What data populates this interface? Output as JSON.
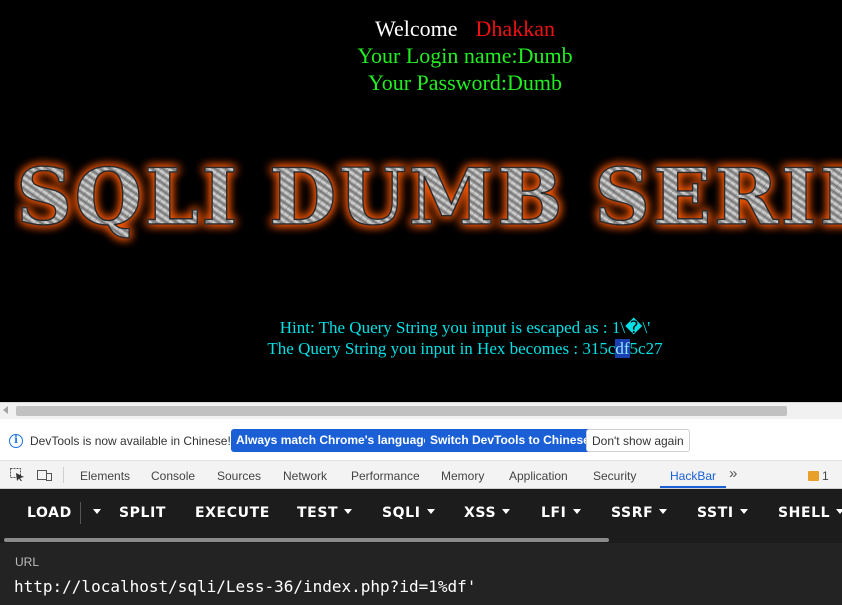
{
  "page": {
    "welcome_label": "Welcome",
    "welcome_name": "Dhakkan",
    "login_line": "Your Login name:Dumb",
    "password_line": "Your Password:Dumb",
    "banner_text": "SQLI DUMB SERIES",
    "hint_line": "Hint: The Query String you input is escaped as : 1\\�\\'",
    "hex_prefix": "The Query String you input in Hex becomes : 315c",
    "hex_selected": "df",
    "hex_suffix": "5c27"
  },
  "devtools_infobar": {
    "message": "DevTools is now available in Chinese!",
    "match_button": "Always match Chrome's language",
    "switch_button": "Switch DevTools to Chinese",
    "dismiss_button": "Don't show again"
  },
  "devtools_tabs": {
    "items": [
      "Elements",
      "Console",
      "Sources",
      "Network",
      "Performance",
      "Memory",
      "Application",
      "Security",
      "HackBar"
    ],
    "active": "HackBar",
    "more_icon": "chevron-double-right",
    "issues_count": "1"
  },
  "hackbar": {
    "menu": [
      "LOAD",
      "SPLIT",
      "EXECUTE",
      "TEST",
      "SQLI",
      "XSS",
      "LFI",
      "SSRF",
      "SSTI",
      "SHELL"
    ],
    "url_label": "URL",
    "url_value": "http://localhost/sqli/Less-36/index.php?id=1%df'"
  },
  "colors": {
    "welcome_name": "#ee1111",
    "login_text": "#22ee22",
    "hint_text": "#00e0e6",
    "banner_glow": "#ff5a00",
    "accent_blue": "#1a5fd6"
  }
}
